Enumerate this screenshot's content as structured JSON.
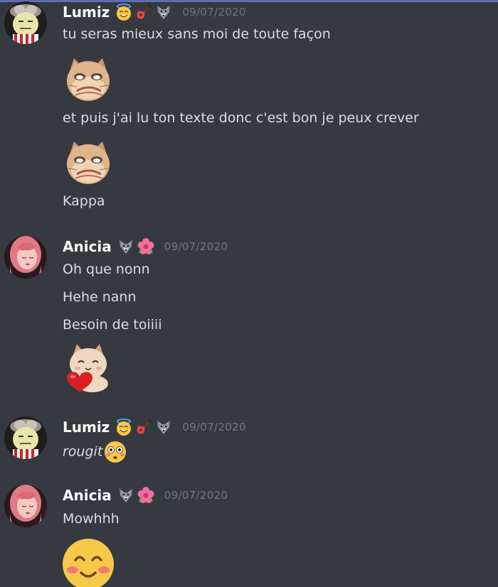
{
  "accent_color": "#5c6fb1",
  "background_color": "#36393f",
  "messages": [
    {
      "username": "Lumiz",
      "timestamp": "09/07/2020",
      "badges": [
        "innocent-smile-emoji",
        "guitar-emoji",
        "wolf-emoji"
      ],
      "lines": [
        "tu seras mieux sans moi de toute façon",
        "et puis j'ai lu ton texte donc c'est bon je peux crever",
        "Kappa"
      ],
      "emotes": [
        "sad-cat-emote",
        "sad-cat-emote"
      ]
    },
    {
      "username": "Anicia",
      "timestamp": "09/07/2020",
      "badges": [
        "wolf-emoji",
        "hibiscus-emoji"
      ],
      "lines": [
        "Oh que nonn",
        "Hehe nann",
        "Besoin de toiiii"
      ],
      "emotes": [
        "heart-cat-emote"
      ]
    },
    {
      "username": "Lumiz",
      "timestamp": "09/07/2020",
      "badges": [
        "innocent-smile-emoji",
        "guitar-emoji",
        "wolf-emoji"
      ],
      "lines": [
        "rougit"
      ],
      "inline_emoji": "flushed-face-emoji"
    },
    {
      "username": "Anicia",
      "timestamp": "09/07/2020",
      "badges": [
        "wolf-emoji",
        "hibiscus-emoji"
      ],
      "lines": [
        "Mowhhh"
      ],
      "emotes": [
        "blushing-smile-emoji"
      ]
    }
  ]
}
